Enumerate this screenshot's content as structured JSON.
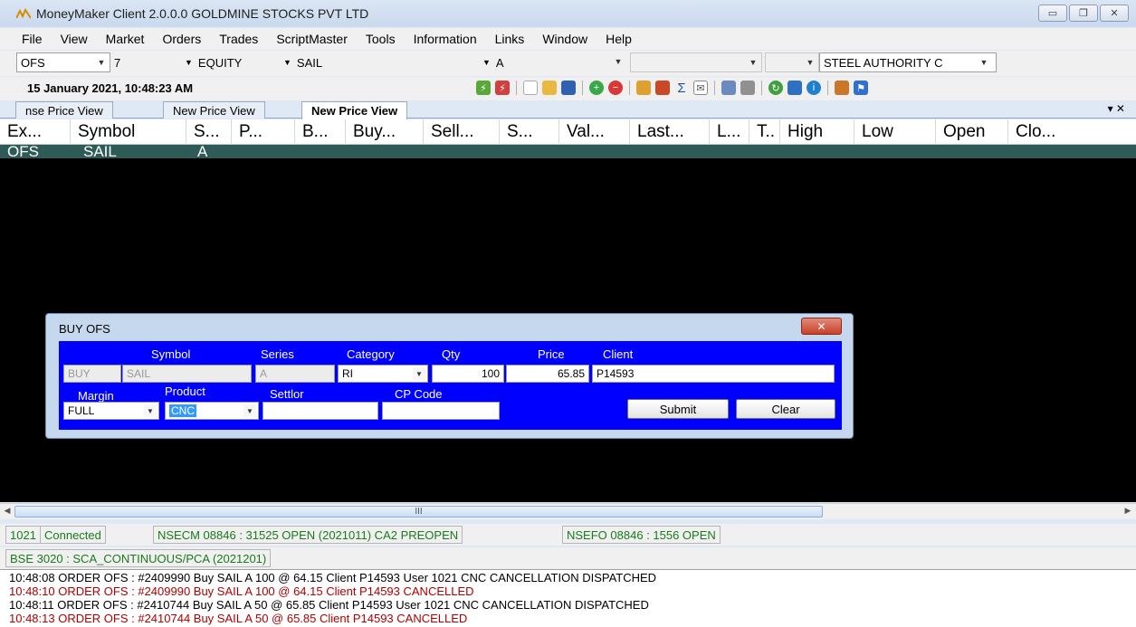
{
  "window": {
    "title": "MoneyMaker Client 2.0.0.0  GOLDMINE STOCKS PVT LTD",
    "minimize_icon": "minimize-icon",
    "restore_icon": "restore-icon",
    "close_icon": "close-icon"
  },
  "menu": [
    "File",
    "View",
    "Market",
    "Orders",
    "Trades",
    "ScriptMaster",
    "Tools",
    "Information",
    "Links",
    "Window",
    "Help"
  ],
  "selectors": {
    "exchange": "OFS",
    "number": "7",
    "segment": "EQUITY",
    "symbol": "SAIL",
    "series": "A",
    "company": "STEEL AUTHORITY C"
  },
  "datetime": "15 January 2021, 10:48:23 AM",
  "tabs": [
    "nse Price View",
    "New Price View",
    "New Price View"
  ],
  "tab_controls": "▾ ✕",
  "grid": {
    "columns": [
      "Ex...",
      "Symbol",
      "S...",
      "P...",
      "B...",
      "Buy...",
      "Sell...",
      "S...",
      "Val...",
      "Last...",
      "L...",
      "T..",
      "High",
      "Low",
      "Open",
      "Clo..."
    ],
    "row": {
      "exchange": "OFS",
      "symbol": "SAIL",
      "series": "A"
    }
  },
  "dialog": {
    "title": "BUY OFS",
    "close_icon": "close-icon",
    "labels": {
      "symbol": "Symbol",
      "series": "Series",
      "category": "Category",
      "qty": "Qty",
      "price": "Price",
      "client": "Client",
      "margin": "Margin",
      "product": "Product",
      "settlor": "Settlor",
      "cp_code": "CP Code"
    },
    "values": {
      "side": "BUY",
      "symbol": "SAIL",
      "series": "A",
      "category": "RI",
      "qty": "100",
      "price": "65.85",
      "client": "P14593",
      "margin": "FULL",
      "product": "CNC",
      "settlor": "",
      "cp_code": ""
    },
    "submit": "Submit",
    "clear": "Clear"
  },
  "scrollbar_grip": "III",
  "status": {
    "panels1": [
      "1021",
      "Connected",
      "NSECM 08846 : 31525  OPEN (2021011) CA2 PREOPEN",
      "NSEFO 08846 : 1556  OPEN"
    ],
    "panels2": [
      "BSE 3020 : SCA_CONTINUOUS/PCA (2021201)"
    ]
  },
  "log": [
    {
      "text": "10:48:08  ORDER OFS : #2409990 Buy SAIL A 100 @ 64.15 Client P14593 User 1021  CNC CANCELLATION DISPATCHED",
      "color": "#000000"
    },
    {
      "text": "10:48:10  ORDER OFS : #2409990 Buy SAIL A 100 @ 64.15 Client P14593 CANCELLED",
      "color": "#b00000"
    },
    {
      "text": "10:48:11  ORDER OFS : #2410744 Buy SAIL A 50 @ 65.85 Client P14593 User 1021  CNC CANCELLATION DISPATCHED",
      "color": "#000000"
    },
    {
      "text": "10:48:13  ORDER OFS : #2410744 Buy SAIL A 50 @ 65.85 Client P14593 CANCELLED",
      "color": "#b00000"
    }
  ],
  "colors": {
    "grid_row": "#2e5b57",
    "dialog_panel": "#0000ff",
    "status_text": "#1a7a1a"
  }
}
